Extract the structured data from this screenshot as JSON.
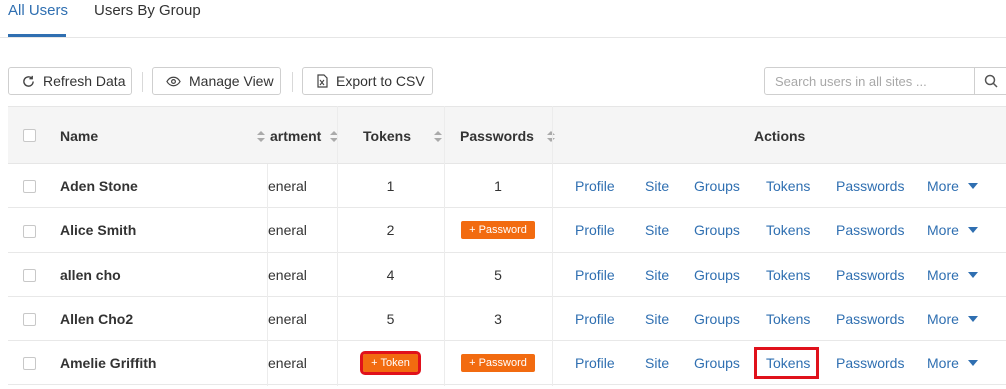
{
  "tabs": [
    {
      "label": "All Users"
    },
    {
      "label": "Users By Group"
    }
  ],
  "toolbar": {
    "refresh_label": "Refresh Data",
    "manage_label": "Manage View",
    "export_label": "Export to CSV"
  },
  "search": {
    "placeholder": "Search users in all sites ..."
  },
  "columns": {
    "name": "Name",
    "department": "artment",
    "tokens": "Tokens",
    "passwords": "Passwords",
    "actions": "Actions"
  },
  "badges": {
    "add_token": "+ Token",
    "add_password": "+ Password"
  },
  "actions": [
    "Profile",
    "Site",
    "Groups",
    "Tokens",
    "Passwords",
    "More"
  ],
  "rows": [
    {
      "name": "Aden Stone",
      "department": "eneral",
      "tokens": "1",
      "passwords": "1"
    },
    {
      "name": "Alice Smith",
      "department": "eneral",
      "tokens": "2",
      "passwords": ""
    },
    {
      "name": "allen cho",
      "department": "eneral",
      "tokens": "4",
      "passwords": "5"
    },
    {
      "name": "Allen Cho2",
      "department": "eneral",
      "tokens": "5",
      "passwords": "3"
    },
    {
      "name": "Amelie Griffith",
      "department": "eneral",
      "tokens": "",
      "passwords": ""
    }
  ],
  "colors": {
    "accent": "#2f6fb1",
    "badge": "#f26b10",
    "highlight": "#e0111b"
  }
}
